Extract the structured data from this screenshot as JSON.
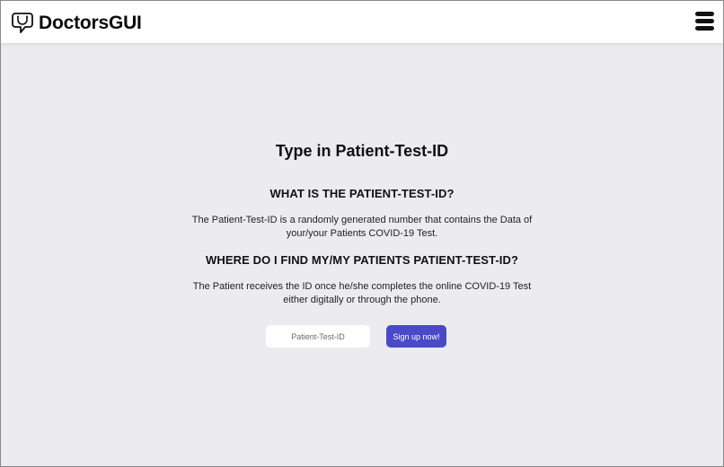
{
  "header": {
    "app_name": "DoctorsGUI",
    "logo_icon": "stethoscope-speech-bubble-icon",
    "menu_icon": "hamburger-menu-icon"
  },
  "main": {
    "title": "Type in Patient-Test-ID",
    "sections": [
      {
        "heading": "WHAT IS THE PATIENT-TEST-ID?",
        "body": "The Patient-Test-ID is a randomly generated number that contains the Data of your/your Patients COVID-19 Test."
      },
      {
        "heading": "WHERE DO I FIND MY/MY PATIENTS PATIENT-TEST-ID?",
        "body": "The Patient receives the ID once he/she completes the online COVID-19 Test either digitally or through the phone."
      }
    ],
    "form": {
      "input_placeholder": "Patient-Test-ID",
      "input_value": "",
      "button_label": "Sign up now!"
    }
  },
  "colors": {
    "background": "#ececf0",
    "header_background": "#ffffff",
    "accent": "#4a4ac7"
  }
}
